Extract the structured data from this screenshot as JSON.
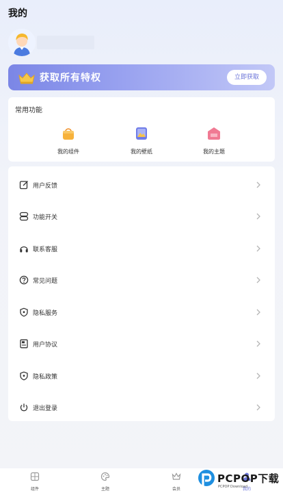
{
  "page": {
    "title": "我的"
  },
  "profile": {
    "avatar_icon": "avatar-boy-icon"
  },
  "vip_banner": {
    "title": "获取所有特权",
    "button_label": "立即获取",
    "icon": "crown-icon",
    "colors": {
      "from": "#7b86e6",
      "to": "#c2c8f7"
    }
  },
  "common": {
    "title": "常用功能",
    "items": [
      {
        "label": "我的组件",
        "icon": "bag-icon",
        "color": "#f5a623"
      },
      {
        "label": "我的壁纸",
        "icon": "wallpaper-icon",
        "color": "#6f7ce8"
      },
      {
        "label": "我的主题",
        "icon": "theme-icon",
        "color": "#f07a93"
      }
    ]
  },
  "menu": {
    "items": [
      {
        "label": "用户反馈",
        "icon": "edit-icon"
      },
      {
        "label": "功能开关",
        "icon": "toggle-icon"
      },
      {
        "label": "联系客服",
        "icon": "headphones-icon"
      },
      {
        "label": "常见问题",
        "icon": "question-icon"
      },
      {
        "label": "隐私服务",
        "icon": "shield-icon"
      },
      {
        "label": "用户协议",
        "icon": "document-icon"
      },
      {
        "label": "隐私政策",
        "icon": "shield-icon"
      },
      {
        "label": "退出登录",
        "icon": "power-icon"
      }
    ]
  },
  "tabbar": {
    "items": [
      {
        "label": "组件",
        "icon": "grid-icon"
      },
      {
        "label": "主题",
        "icon": "palette-icon"
      },
      {
        "label": "会员",
        "icon": "crown-icon"
      },
      {
        "label": "我的",
        "icon": "user-icon",
        "active": true
      }
    ]
  },
  "watermark": {
    "text": "PCPOP下载",
    "sub": "PCPOP Download"
  }
}
